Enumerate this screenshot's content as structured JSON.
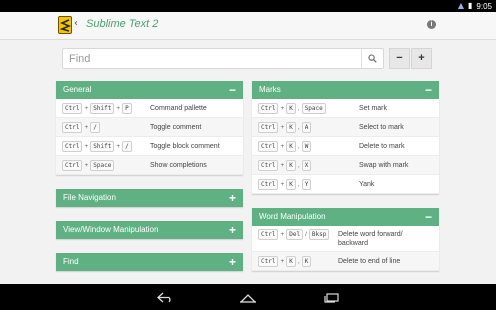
{
  "status": {
    "time": "9:05"
  },
  "app": {
    "title": "Sublime Text 2"
  },
  "search": {
    "placeholder": "Find"
  },
  "zoom": {
    "minus": "−",
    "plus": "+"
  },
  "toggle": {
    "collapse": "−",
    "expand": "+"
  },
  "panels": {
    "general": {
      "title": "General",
      "rows": [
        {
          "keys": [
            "Ctrl",
            "Shift",
            "P"
          ],
          "desc": "Command pallette"
        },
        {
          "keys": [
            "Ctrl",
            "/"
          ],
          "desc": "Toggle comment"
        },
        {
          "keys": [
            "Ctrl",
            "Shift",
            "/"
          ],
          "desc": "Toggle block comment"
        },
        {
          "keys": [
            "Ctrl",
            "Space"
          ],
          "desc": "Show completions"
        }
      ]
    },
    "file_navigation": {
      "title": "File Navigation"
    },
    "view_window": {
      "title": "View/Window Manipulation"
    },
    "find": {
      "title": "Find"
    },
    "marks": {
      "title": "Marks",
      "rows": [
        {
          "keys": [
            "Ctrl",
            "K",
            "Space"
          ],
          "desc": "Set mark"
        },
        {
          "keys": [
            "Ctrl",
            "K",
            "A"
          ],
          "desc": "Select to mark"
        },
        {
          "keys": [
            "Ctrl",
            "K",
            "W"
          ],
          "desc": "Delete to mark"
        },
        {
          "keys": [
            "Ctrl",
            "K",
            "X"
          ],
          "desc": "Swap with mark"
        },
        {
          "keys": [
            "Ctrl",
            "K",
            "Y"
          ],
          "desc": "Yank"
        }
      ]
    },
    "word_manipulation": {
      "title": "Word Manipulation",
      "rows": [
        {
          "keys": [
            "Ctrl",
            "Del",
            "Bksp"
          ],
          "desc": "Delete word forward/ backward"
        },
        {
          "keys": [
            "Ctrl",
            "K",
            "K"
          ],
          "desc": "Delete to end of line"
        }
      ]
    }
  }
}
